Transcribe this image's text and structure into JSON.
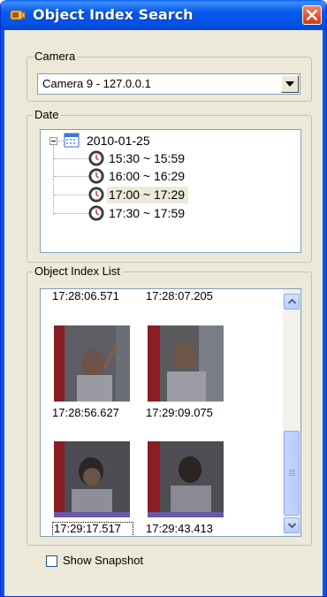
{
  "window": {
    "title": "Object Index Search"
  },
  "camera": {
    "label": "Camera",
    "selected": "Camera 9 - 127.0.0.1"
  },
  "date": {
    "label": "Date",
    "root": "2010-01-25",
    "ranges": [
      "15:30 ~ 15:59",
      "16:00 ~ 16:29",
      "17:00 ~ 17:29",
      "17:30 ~ 17:59"
    ],
    "selected_index": 2
  },
  "object_index": {
    "label": "Object Index List",
    "partial_row": [
      "17:28:06.571",
      "17:28:07.205"
    ],
    "snapshots": [
      {
        "time": "17:28:56.627"
      },
      {
        "time": "17:29:09.075"
      },
      {
        "time": "17:29:17.517"
      },
      {
        "time": "17:29:43.413"
      }
    ],
    "focused_index": 2
  },
  "show_snapshot": {
    "label": "Show Snapshot",
    "checked": false
  },
  "icons": {
    "title": "app-icon",
    "close": "close-icon",
    "calendar": "calendar-icon",
    "clock": "clock-icon",
    "dropdown": "chevron-down-icon"
  },
  "colors": {
    "titlebar": "#0659ec",
    "close": "#e0512b",
    "face": "#ece9d8",
    "selection": "#ece9d8"
  }
}
